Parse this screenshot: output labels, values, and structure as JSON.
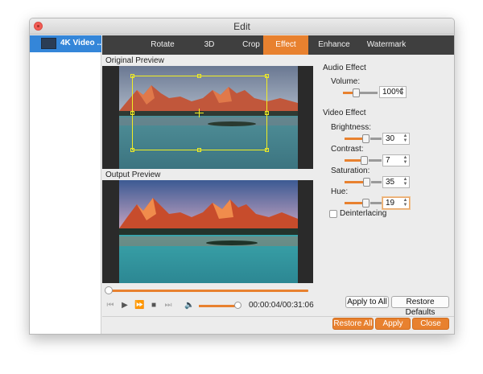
{
  "window": {
    "title": "Edit"
  },
  "sidebar": {
    "items": [
      {
        "label": "4K Video ..."
      }
    ]
  },
  "tabs": [
    {
      "label": "Rotate",
      "active": false
    },
    {
      "label": "3D",
      "active": false
    },
    {
      "label": "Crop",
      "active": false
    },
    {
      "label": "Effect",
      "active": true
    },
    {
      "label": "Enhance",
      "active": false
    },
    {
      "label": "Watermark",
      "active": false
    }
  ],
  "preview": {
    "original_label": "Original Preview",
    "output_label": "Output Preview"
  },
  "playback": {
    "time": "00:00:04/00:31:06",
    "progress": 0.0,
    "volume": 1.0
  },
  "audio": {
    "title": "Audio Effect",
    "volume_label": "Volume:",
    "volume_value": "100%",
    "volume_level": 0.5
  },
  "video": {
    "title": "Video Effect",
    "brightness_label": "Brightness:",
    "brightness_value": "30",
    "brightness_level": 0.55,
    "contrast_label": "Contrast:",
    "contrast_value": "7",
    "contrast_level": 0.52,
    "saturation_label": "Saturation:",
    "saturation_value": "35",
    "saturation_level": 0.57,
    "hue_label": "Hue:",
    "hue_value": "19",
    "hue_level": 0.54,
    "deinterlacing_label": "Deinterlacing",
    "deinterlacing_checked": false
  },
  "buttons": {
    "apply_to_all": "Apply to All",
    "restore_defaults": "Restore Defaults",
    "restore_all": "Restore All",
    "apply": "Apply",
    "close": "Close"
  },
  "colors": {
    "accent": "#e8812f",
    "tabbar": "#3f3f3f",
    "selection": "#3486d9",
    "crop": "#f2ee23"
  }
}
